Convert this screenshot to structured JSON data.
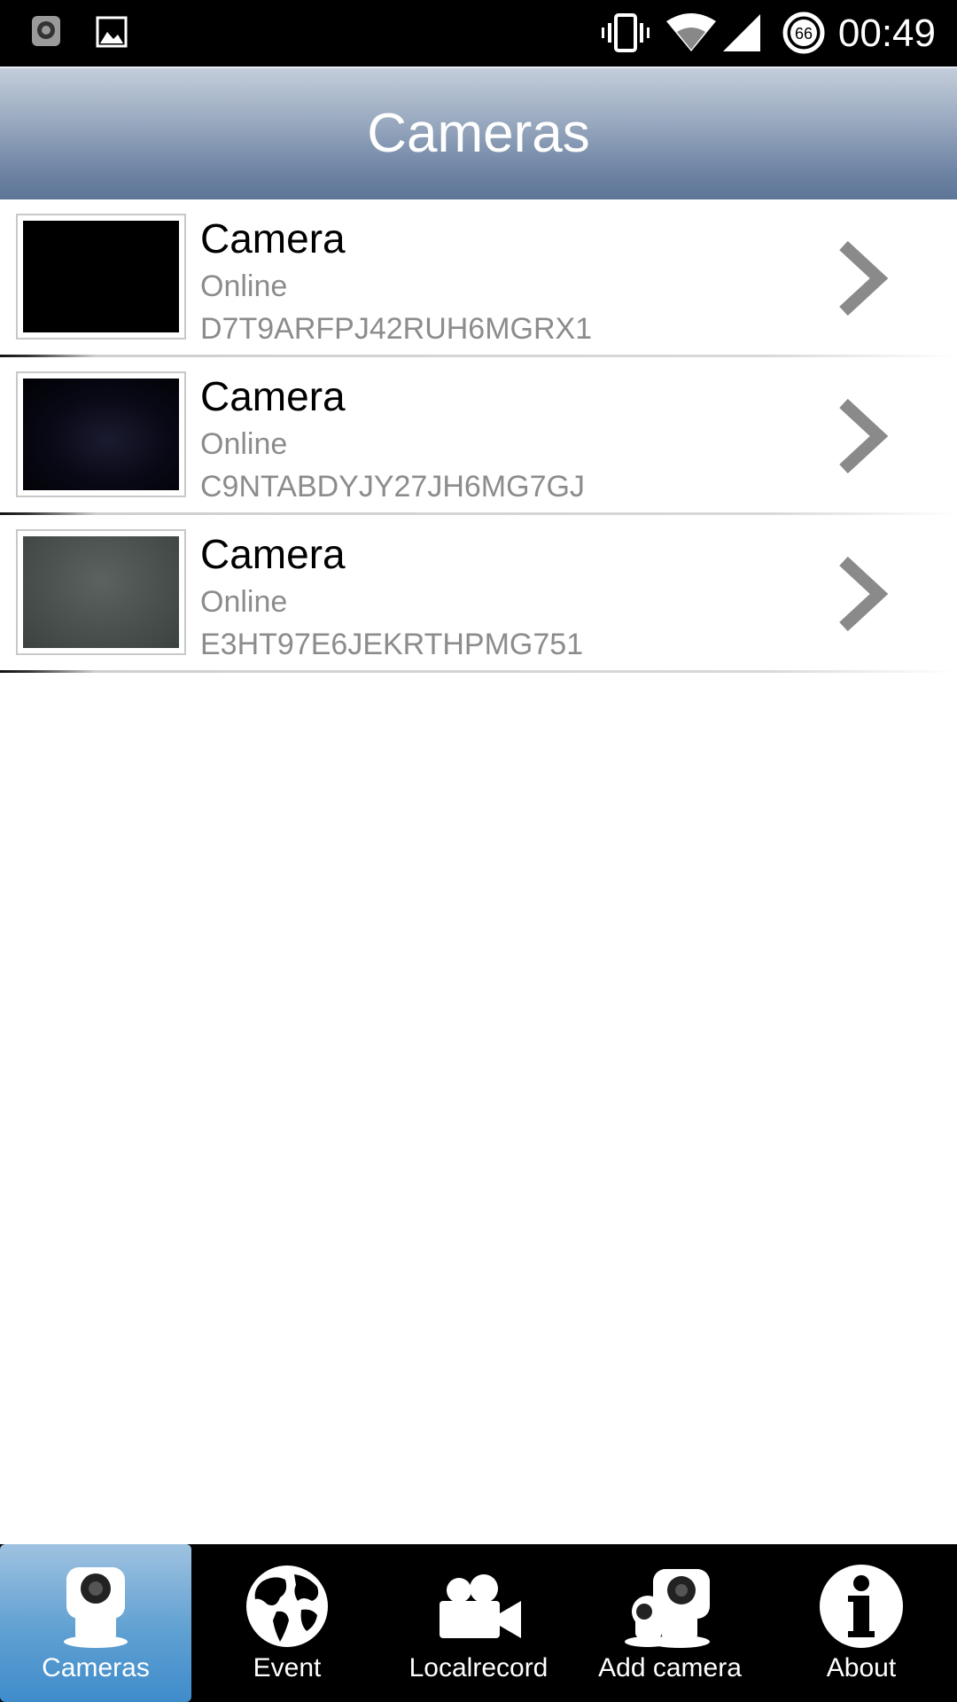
{
  "status_bar": {
    "time": "00:49",
    "battery_level": "66",
    "icons": [
      "camera-notification-icon",
      "image-notification-icon",
      "vibrate-icon",
      "wifi-icon",
      "cell-signal-icon",
      "battery-icon"
    ]
  },
  "header": {
    "title": "Cameras"
  },
  "cameras": [
    {
      "name": "Camera",
      "status": "Online",
      "id": "D7T9ARFPJ42RUH6MGRX1"
    },
    {
      "name": "Camera",
      "status": "Online",
      "id": "C9NTABDYJY27JH6MG7GJ"
    },
    {
      "name": "Camera",
      "status": "Online",
      "id": "E3HT97E6JEKRTHPMG751"
    }
  ],
  "tabs": [
    {
      "label": "Cameras",
      "icon": "camera-icon",
      "active": true
    },
    {
      "label": "Event",
      "icon": "globe-icon",
      "active": false
    },
    {
      "label": "Localrecord",
      "icon": "video-camera-icon",
      "active": false
    },
    {
      "label": "Add camera",
      "icon": "add-camera-icon",
      "active": false
    },
    {
      "label": "About",
      "icon": "info-icon",
      "active": false
    }
  ],
  "colors": {
    "title_bar_top": "#c3cddb",
    "title_bar_bottom": "#5d7597",
    "active_tab": "#5fa0d2",
    "secondary_text": "#8c8c8c"
  }
}
